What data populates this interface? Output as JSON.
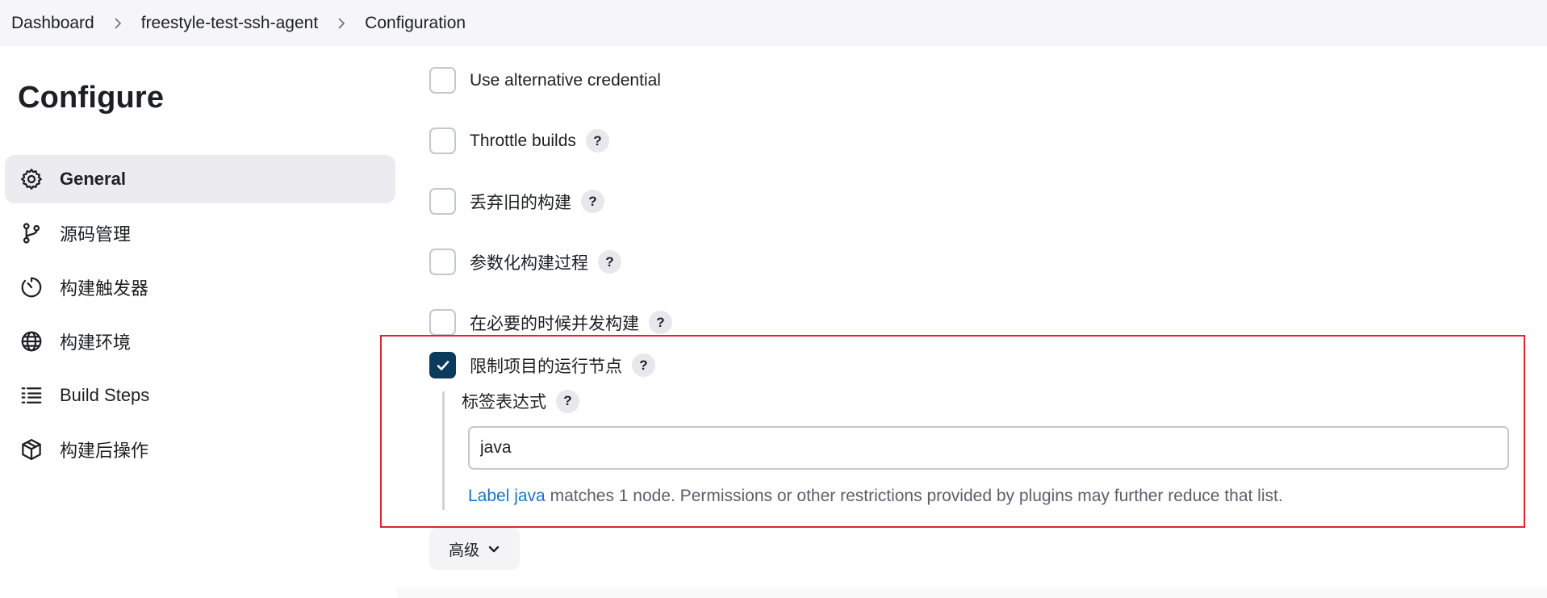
{
  "breadcrumb": {
    "items": [
      "Dashboard",
      "freestyle-test-ssh-agent",
      "Configuration"
    ]
  },
  "page": {
    "title": "Configure"
  },
  "sidebar": {
    "items": [
      {
        "label": "General",
        "icon": "gear-icon",
        "active": true
      },
      {
        "label": "源码管理",
        "icon": "git-branch-icon",
        "active": false
      },
      {
        "label": "构建触发器",
        "icon": "timer-icon",
        "active": false
      },
      {
        "label": "构建环境",
        "icon": "globe-icon",
        "active": false
      },
      {
        "label": "Build Steps",
        "icon": "list-icon",
        "active": false
      },
      {
        "label": "构建后操作",
        "icon": "package-icon",
        "active": false
      }
    ]
  },
  "options": [
    {
      "label": "Use alternative credential",
      "checked": false,
      "help": false
    },
    {
      "label": "Throttle builds",
      "checked": false,
      "help": true
    },
    {
      "label": "丢弃旧的构建",
      "checked": false,
      "help": true
    },
    {
      "label": "参数化构建过程",
      "checked": false,
      "help": true
    },
    {
      "label": "在必要的时候并发构建",
      "checked": false,
      "help": true
    },
    {
      "label": "限制项目的运行节点",
      "checked": true,
      "help": true
    }
  ],
  "restrict": {
    "field_label": "标签表达式",
    "value": "java",
    "link_text": "Label java",
    "message": " matches 1 node. Permissions or other restrictions provided by plugins may further reduce that list."
  },
  "help_symbol": "?",
  "advanced": {
    "label": "高级"
  },
  "colors": {
    "accent": "#0b3b5c",
    "highlight": "#e0242c",
    "link": "#1a73c9"
  }
}
